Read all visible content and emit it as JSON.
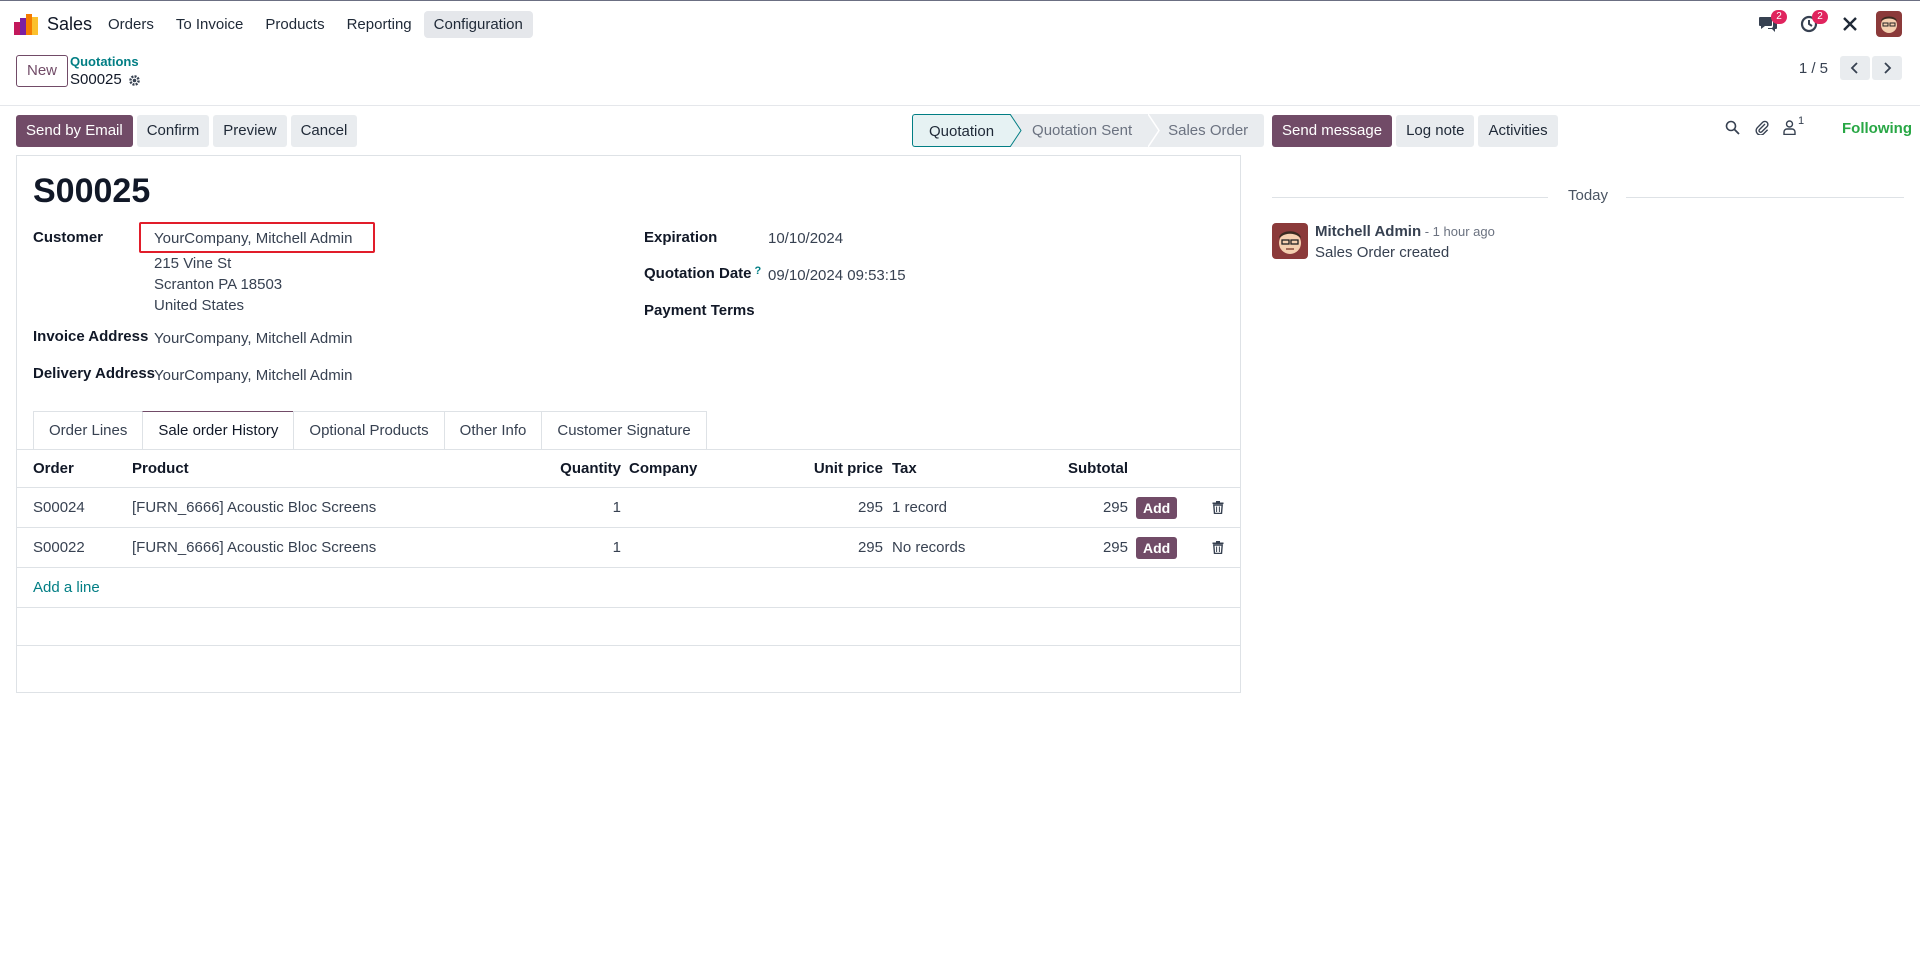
{
  "topbar": {
    "app_name": "Sales",
    "menu": [
      "Orders",
      "To Invoice",
      "Products",
      "Reporting",
      "Configuration"
    ],
    "active_menu": "Configuration",
    "messages_badge": "2",
    "activities_badge": "2"
  },
  "control": {
    "new_label": "New",
    "breadcrumb_parent": "Quotations",
    "breadcrumb_current": "S00025",
    "pager_value": "1 / 5"
  },
  "actions": {
    "send_email": "Send by Email",
    "confirm": "Confirm",
    "preview": "Preview",
    "cancel": "Cancel"
  },
  "status": {
    "steps": [
      "Quotation",
      "Quotation Sent",
      "Sales Order"
    ],
    "current": "Quotation"
  },
  "form": {
    "title": "S00025",
    "customer_label": "Customer",
    "customer_value": "YourCompany, Mitchell Admin",
    "address_line1": "215 Vine St",
    "address_line2": "Scranton PA 18503",
    "address_line3": "United States",
    "invoice_label": "Invoice Address",
    "invoice_value": "YourCompany, Mitchell Admin",
    "delivery_label": "Delivery Address",
    "delivery_value": "YourCompany, Mitchell Admin",
    "expiration_label": "Expiration",
    "expiration_value": "10/10/2024",
    "quotation_date_label": "Quotation Date",
    "quotation_date_help": "?",
    "quotation_date_value": "09/10/2024 09:53:15",
    "payment_terms_label": "Payment Terms"
  },
  "tabs": [
    "Order Lines",
    "Sale order History",
    "Optional Products",
    "Other Info",
    "Customer Signature"
  ],
  "active_tab": "Sale order History",
  "table": {
    "headers": {
      "order": "Order",
      "product": "Product",
      "quantity": "Quantity",
      "company": "Company",
      "unit_price": "Unit price",
      "tax": "Tax",
      "subtotal": "Subtotal"
    },
    "rows": [
      {
        "order": "S00024",
        "product": "[FURN_6666] Acoustic Bloc Screens",
        "quantity": "1",
        "company": "",
        "unit_price": "295",
        "tax": "1 record",
        "subtotal": "295",
        "add": "Add"
      },
      {
        "order": "S00022",
        "product": "[FURN_6666] Acoustic Bloc Screens",
        "quantity": "1",
        "company": "",
        "unit_price": "295",
        "tax": "No records",
        "subtotal": "295",
        "add": "Add"
      }
    ],
    "add_line": "Add a line"
  },
  "chatter": {
    "send_message": "Send message",
    "log_note": "Log note",
    "activities": "Activities",
    "follower_count": "1",
    "following": "Following",
    "date_separator": "Today",
    "message": {
      "author": "Mitchell Admin",
      "time": " - 1 hour ago",
      "body": "Sales Order created"
    }
  },
  "colors": {
    "primary": "#714b67",
    "link": "#017e84",
    "following": "#28a745",
    "highlight_box": "#e11d2a",
    "badge": "#e0245e"
  }
}
